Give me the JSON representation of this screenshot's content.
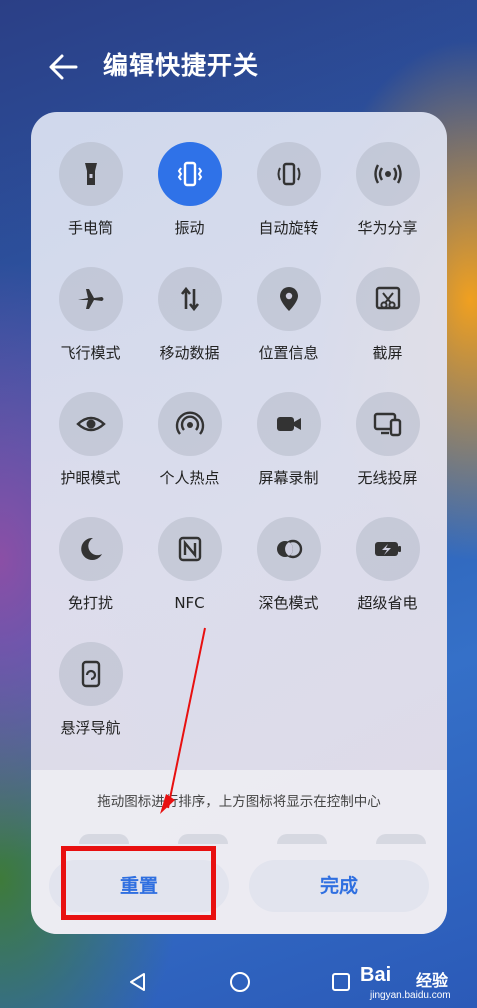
{
  "header": {
    "title": "编辑快捷开关"
  },
  "tiles": [
    {
      "label": "手电筒",
      "icon": "flashlight-icon",
      "active": false
    },
    {
      "label": "振动",
      "icon": "vibrate-icon",
      "active": true
    },
    {
      "label": "自动旋转",
      "icon": "auto-rotate-icon",
      "active": false
    },
    {
      "label": "华为分享",
      "icon": "huawei-share-icon",
      "active": false
    },
    {
      "label": "飞行模式",
      "icon": "airplane-icon",
      "active": false
    },
    {
      "label": "移动数据",
      "icon": "mobile-data-icon",
      "active": false
    },
    {
      "label": "位置信息",
      "icon": "location-icon",
      "active": false
    },
    {
      "label": "截屏",
      "icon": "screenshot-icon",
      "active": false
    },
    {
      "label": "护眼模式",
      "icon": "eye-comfort-icon",
      "active": false
    },
    {
      "label": "个人热点",
      "icon": "hotspot-icon",
      "active": false
    },
    {
      "label": "屏幕录制",
      "icon": "screen-record-icon",
      "active": false
    },
    {
      "label": "无线投屏",
      "icon": "wireless-projection-icon",
      "active": false
    },
    {
      "label": "免打扰",
      "icon": "do-not-disturb-icon",
      "active": false
    },
    {
      "label": "NFC",
      "icon": "nfc-icon",
      "active": false
    },
    {
      "label": "深色模式",
      "icon": "dark-mode-icon",
      "active": false
    },
    {
      "label": "超级省电",
      "icon": "power-saving-icon",
      "active": false
    },
    {
      "label": "悬浮导航",
      "icon": "floating-navigation-icon",
      "active": false
    }
  ],
  "bottom": {
    "hint": "拖动图标进行排序，上方图标将显示在控制中心",
    "reset_label": "重置",
    "done_label": "完成"
  },
  "watermark": {
    "logo": "Bai",
    "text": "经验",
    "sub": "jingyan.baidu.com"
  },
  "colors": {
    "accent": "#2f72e8",
    "highlight": "#e81010",
    "button_text": "#2f6fe0"
  }
}
